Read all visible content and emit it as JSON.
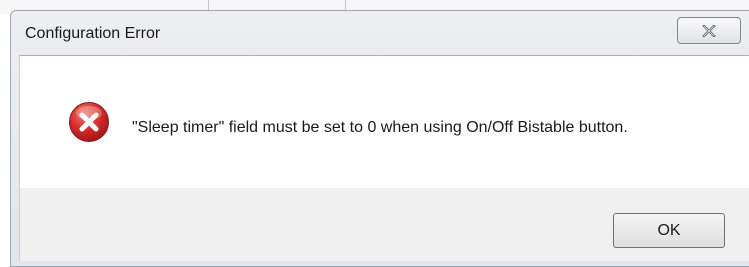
{
  "dialog": {
    "title": "Configuration Error",
    "close_icon": "close-x-icon",
    "icon": "error-icon",
    "message": "\"Sleep timer\" field must be set to 0 when using On/Off Bistable button.",
    "ok_label": "OK"
  },
  "colors": {
    "error_red": "#d32a2a",
    "client_bg": "#f0f0f0",
    "message_bg": "#ffffff"
  }
}
